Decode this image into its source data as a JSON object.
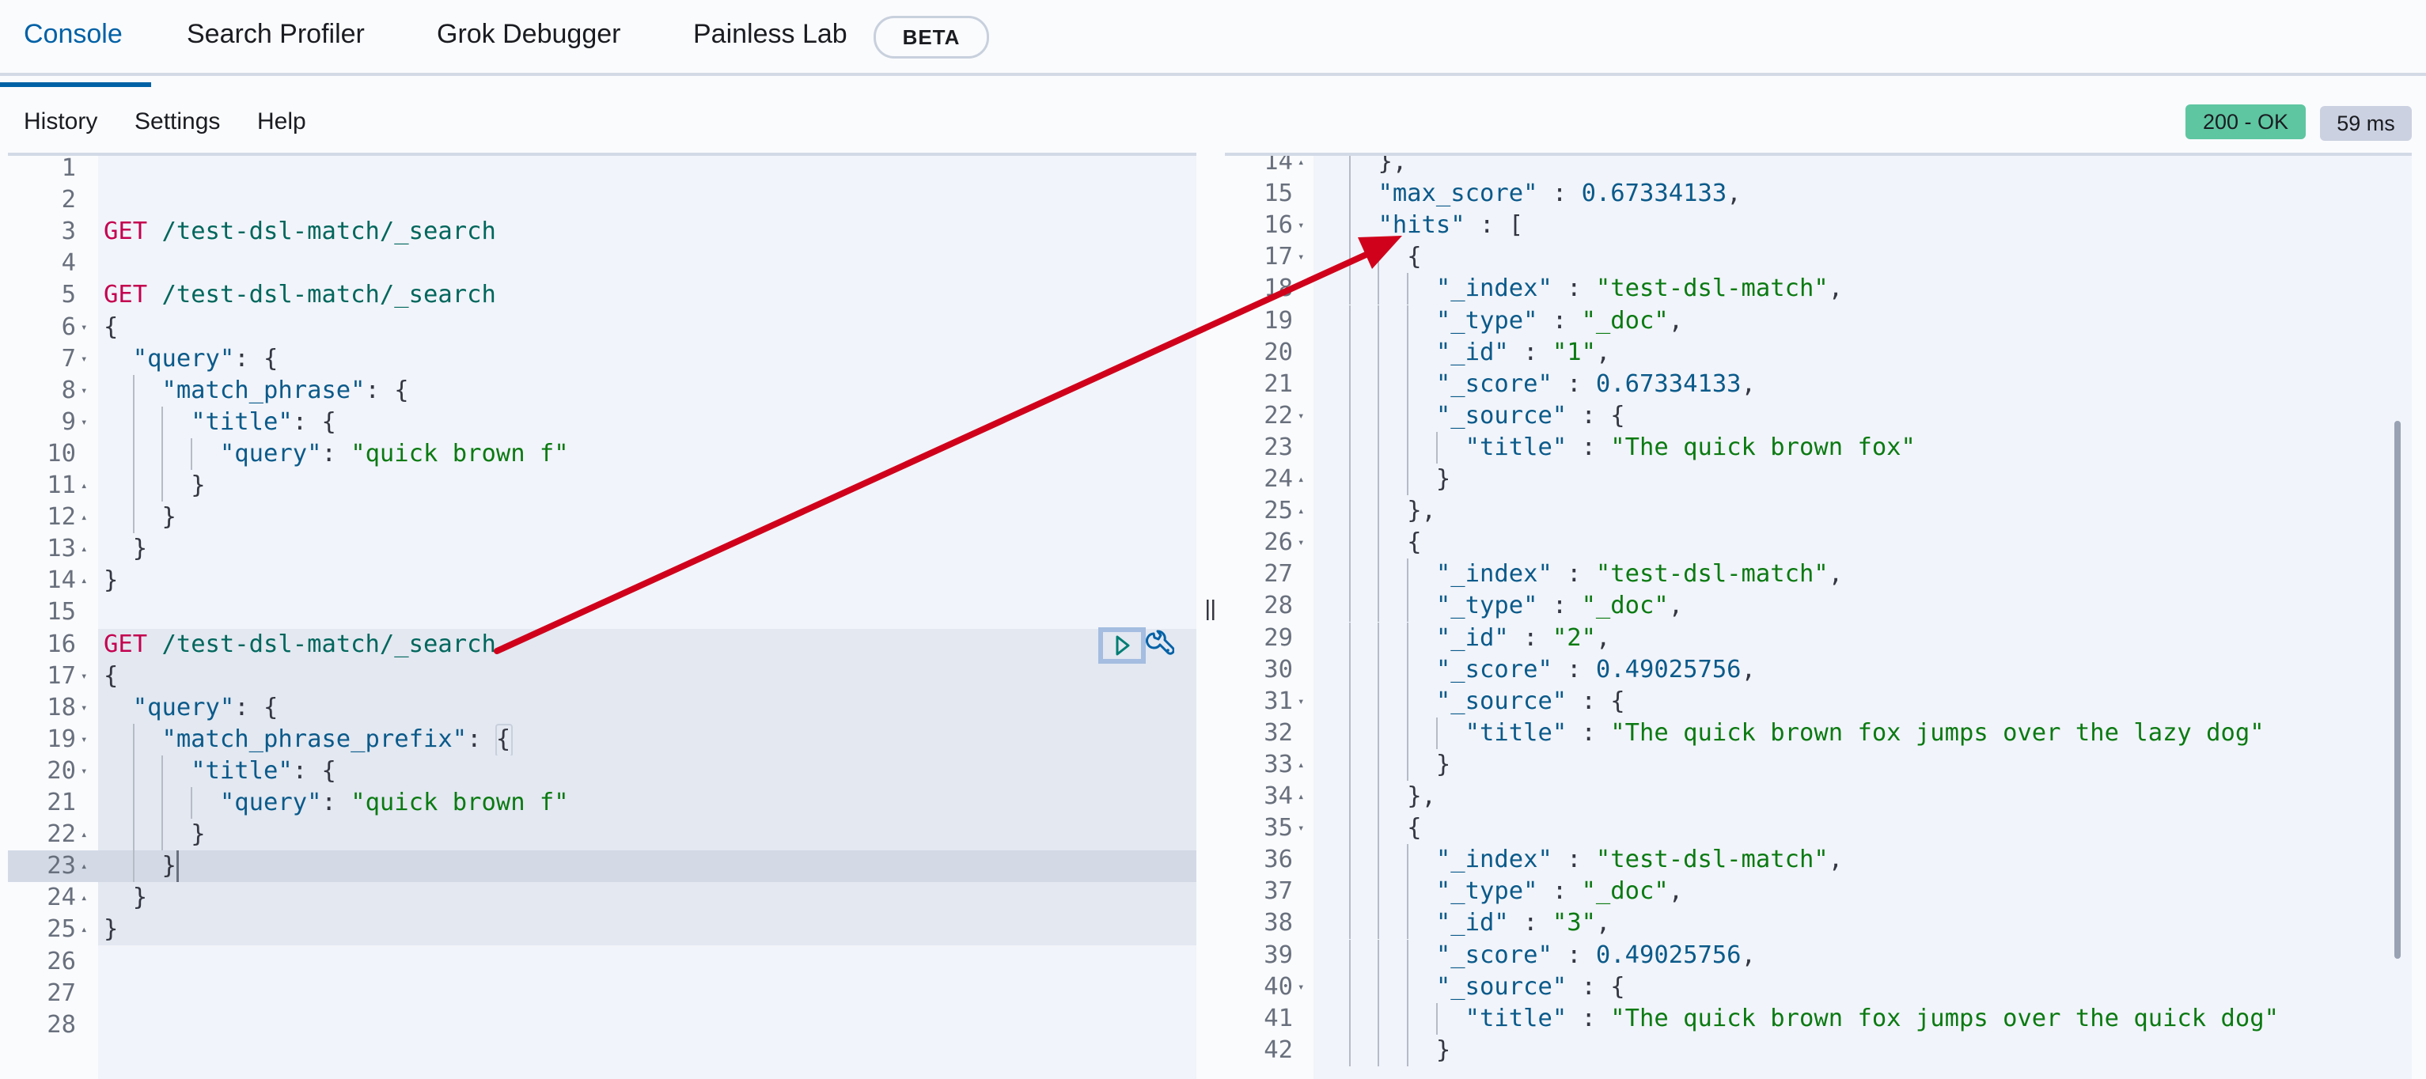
{
  "tabs": [
    {
      "label": "Console",
      "active": true
    },
    {
      "label": "Search Profiler"
    },
    {
      "label": "Grok Debugger"
    },
    {
      "label": "Painless Lab",
      "badge": "BETA"
    }
  ],
  "toolbar": {
    "history": "History",
    "settings": "Settings",
    "help": "Help"
  },
  "status": {
    "code": "200 - OK",
    "time": "59 ms",
    "ok_color": "#5ec6a1",
    "time_color": "#cbd1e0"
  },
  "icons": {
    "run": "play-icon",
    "settings": "wrench-icon",
    "resize": "divider-handle-icon"
  },
  "request_editor": {
    "first_line": 1,
    "highlighted_lines": [
      16,
      25
    ],
    "active_line": 23,
    "fold_open": [
      6,
      7,
      8,
      9,
      17,
      18,
      19,
      20
    ],
    "fold_close": [
      11,
      12,
      13,
      14,
      22,
      23,
      24,
      25
    ],
    "lines": [
      "",
      "",
      "GET /test-dsl-match/_search",
      "",
      "GET /test-dsl-match/_search",
      "{",
      "  \"query\": {",
      "    \"match_phrase\": {",
      "      \"title\": {",
      "        \"query\": \"quick brown f\"",
      "      }",
      "    }",
      "  }",
      "}",
      "",
      "GET /test-dsl-match/_search",
      "{",
      "  \"query\": {",
      "    \"match_phrase_prefix\": {",
      "      \"title\": {",
      "        \"query\": \"quick brown f\"",
      "      }",
      "    }",
      "  }",
      "}",
      "",
      "",
      ""
    ]
  },
  "response_editor": {
    "first_line": 14,
    "fold_open": [
      16,
      17,
      22,
      26,
      31,
      35,
      40
    ],
    "fold_close": [
      14,
      24,
      25,
      33,
      34
    ],
    "lines": [
      "    },",
      "    \"max_score\" : 0.67334133,",
      "    \"hits\" : [",
      "      {",
      "        \"_index\" : \"test-dsl-match\",",
      "        \"_type\" : \"_doc\",",
      "        \"_id\" : \"1\",",
      "        \"_score\" : 0.67334133,",
      "        \"_source\" : {",
      "          \"title\" : \"The quick brown fox\"",
      "        }",
      "      },",
      "      {",
      "        \"_index\" : \"test-dsl-match\",",
      "        \"_type\" : \"_doc\",",
      "        \"_id\" : \"2\",",
      "        \"_score\" : 0.49025756,",
      "        \"_source\" : {",
      "          \"title\" : \"The quick brown fox jumps over the lazy dog\"",
      "        }",
      "      },",
      "      {",
      "        \"_index\" : \"test-dsl-match\",",
      "        \"_type\" : \"_doc\",",
      "        \"_id\" : \"3\",",
      "        \"_score\" : 0.49025756,",
      "        \"_source\" : {",
      "          \"title\" : \"The quick brown fox jumps over the quick dog\"",
      "        }"
    ]
  },
  "annotation": {
    "type": "arrow",
    "color": "#d0021b",
    "from": "request line 16",
    "to": "response \"hits\""
  }
}
